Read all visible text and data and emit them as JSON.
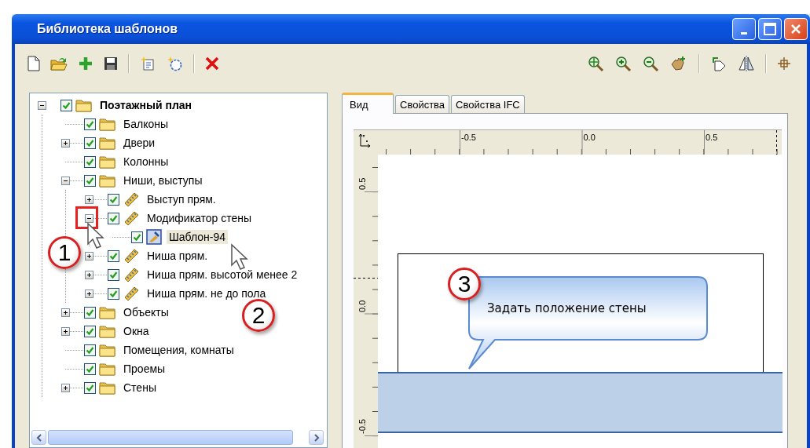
{
  "window": {
    "title": "Библиотека шаблонов"
  },
  "tree": {
    "items": [
      {
        "label": "Поэтажный план",
        "kind": "folder",
        "checked": true,
        "selected": false,
        "expanded": true,
        "children": [
          {
            "label": "Балконы",
            "kind": "folder",
            "checked": true,
            "selected": false
          },
          {
            "label": "Двери",
            "kind": "folder",
            "checked": true,
            "selected": false,
            "expanded": false
          },
          {
            "label": "Колонны",
            "kind": "folder",
            "checked": true,
            "selected": false
          },
          {
            "label": "Ниши, выступы",
            "kind": "folder",
            "checked": true,
            "selected": false,
            "expanded": true,
            "children": [
              {
                "label": "Выступ прям.",
                "kind": "element",
                "checked": true,
                "selected": false,
                "expanded": false
              },
              {
                "label": "Модификатор стены",
                "kind": "element",
                "checked": true,
                "selected": false,
                "expanded": true,
                "children": [
                  {
                    "label": "Шаблон-94",
                    "kind": "template",
                    "checked": true,
                    "selected": true
                  }
                ]
              },
              {
                "label": "Ниша прям.",
                "kind": "element",
                "checked": true,
                "selected": false,
                "expanded": false
              },
              {
                "label": "Ниша прям. высотой менее 2",
                "kind": "element",
                "checked": true,
                "selected": false,
                "expanded": false
              },
              {
                "label": "Ниша прям. не до пола",
                "kind": "element",
                "checked": true,
                "selected": false,
                "expanded": false
              }
            ]
          },
          {
            "label": "Объекты",
            "kind": "folder",
            "checked": true,
            "selected": false,
            "expanded": false
          },
          {
            "label": "Окна",
            "kind": "folder",
            "checked": true,
            "selected": false,
            "expanded": false
          },
          {
            "label": "Помещения, комнаты",
            "kind": "folder",
            "checked": true,
            "selected": false
          },
          {
            "label": "Проемы",
            "kind": "folder",
            "checked": true,
            "selected": false
          },
          {
            "label": "Стены",
            "kind": "folder",
            "checked": true,
            "selected": false,
            "expanded": false
          }
        ]
      }
    ]
  },
  "tabs": [
    {
      "label": "Вид",
      "selected": true
    },
    {
      "label": "Свойства",
      "selected": false
    },
    {
      "label": "Свойства IFC",
      "selected": false
    }
  ],
  "view": {
    "x_ruler": [
      "-0.5",
      "0.0",
      "0.5"
    ],
    "y_ruler": [
      "0.5",
      "0.0",
      "-0.5"
    ]
  },
  "callouts": [
    {
      "number": "1"
    },
    {
      "number": "2"
    },
    {
      "number": "3",
      "text": "Задать положение стены"
    }
  ]
}
